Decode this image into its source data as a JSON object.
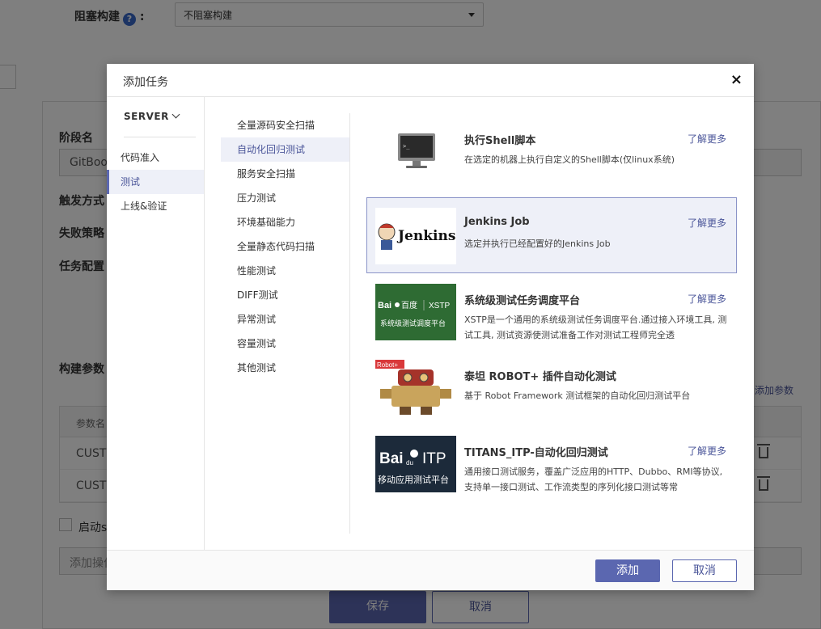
{
  "background": {
    "block_build_label": "阻塞构建",
    "block_build_select": "不阻塞构建",
    "stage_name_label": "阶段名",
    "stage_name_value": "GitBook",
    "trigger_label": "触发方式",
    "fail_label": "失败策略",
    "task_config_label": "任务配置",
    "build_params_label": "构建参数",
    "add_param_link": "添加参数",
    "params_header": "参数名",
    "param_rows": [
      "CUST",
      "CUST"
    ],
    "start_checkbox_label": "启动s",
    "add_op_placeholder": "添加操作",
    "save_button": "保存",
    "cancel_button": "取消"
  },
  "modal": {
    "title": "添加任务",
    "close_symbol": "×",
    "server_label": "SERVER",
    "categories": [
      {
        "label": "代码准入"
      },
      {
        "label": "测试"
      },
      {
        "label": "上线&验证"
      }
    ],
    "subcategories": [
      {
        "label": "全量源码安全扫描"
      },
      {
        "label": "自动化回归测试"
      },
      {
        "label": "服务安全扫描"
      },
      {
        "label": "压力测试"
      },
      {
        "label": "环境基础能力"
      },
      {
        "label": "全量静态代码扫描"
      },
      {
        "label": "性能测试"
      },
      {
        "label": "DIFF测试"
      },
      {
        "label": "异常测试"
      },
      {
        "label": "容量测试"
      },
      {
        "label": "其他测试"
      }
    ],
    "tasks": [
      {
        "title": "执行Shell脚本",
        "desc": "在选定的机器上执行自定义的Shell脚本(仅linux系统)",
        "more": "了解更多"
      },
      {
        "title": "Jenkins Job",
        "desc": "选定并执行已经配置好的Jenkins Job",
        "more": "了解更多",
        "logo_text": "Jenkins"
      },
      {
        "title": "系统级测试任务调度平台",
        "desc": "XSTP是一个通用的系统级测试任务调度平台.通过接入环境工具, 测试工具, 测试资源使测试准备工作对测试工程师完全透",
        "more": "了解更多",
        "logo_top": "百度 | XSTP",
        "logo_bottom": "系统级测试调度平台"
      },
      {
        "title": "泰坦 ROBOT+ 插件自动化测试",
        "desc": "基于 Robot Framework 测试框架的自动化回归测试平台",
        "more": "",
        "logo_text": "Robot+"
      },
      {
        "title": "TITANS_ITP-自动化回归测试",
        "desc": "通用接口测试服务，覆盖广泛应用的HTTP、Dubbo、RMI等协议, 支持单一接口测试、工作流类型的序列化接口测试等常",
        "more": "了解更多",
        "logo_top": "Baidu ITP",
        "logo_bottom": "移动应用测试平台"
      }
    ],
    "add_button": "添加",
    "cancel_button": "取消"
  },
  "colors": {
    "accent": "#5b67b0",
    "link": "#4a5599",
    "selected_bg": "#eef0f8",
    "baidu_green": "#2e6b33",
    "itp_dark": "#1c2a3a"
  }
}
